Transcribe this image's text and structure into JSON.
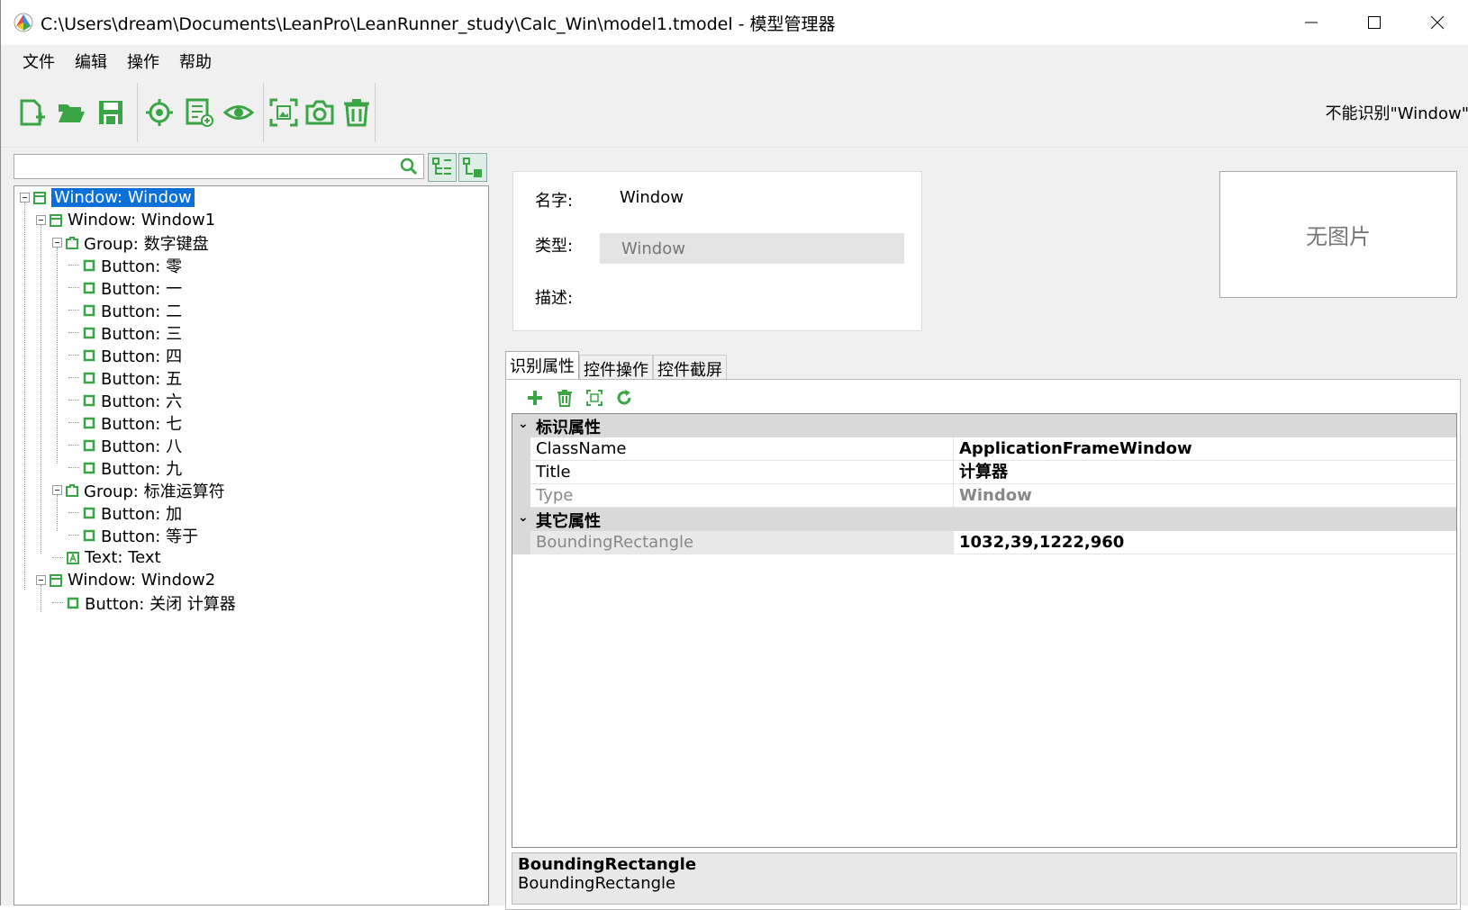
{
  "window": {
    "title": "C:\\Users\\dream\\Documents\\LeanPro\\LeanRunner_study\\Calc_Win\\model1.tmodel - 模型管理器"
  },
  "menu": [
    "文件",
    "编辑",
    "操作",
    "帮助"
  ],
  "toolbar": {
    "status_text": "不能识别\"Window\""
  },
  "tree": {
    "items": [
      {
        "label": "Window: Window"
      },
      {
        "label": "Window: Window1"
      },
      {
        "label": "Group: 数字键盘"
      },
      {
        "label": "Button: 零"
      },
      {
        "label": "Button: 一"
      },
      {
        "label": "Button: 二"
      },
      {
        "label": "Button: 三"
      },
      {
        "label": "Button: 四"
      },
      {
        "label": "Button: 五"
      },
      {
        "label": "Button: 六"
      },
      {
        "label": "Button: 七"
      },
      {
        "label": "Button: 八"
      },
      {
        "label": "Button: 九"
      },
      {
        "label": "Group: 标准运算符"
      },
      {
        "label": "Button: 加"
      },
      {
        "label": "Button: 等于"
      },
      {
        "label": "Text: Text"
      },
      {
        "label": "Window: Window2"
      },
      {
        "label": "Button: 关闭 计算器"
      }
    ]
  },
  "info": {
    "name_label": "名字:",
    "name_value": "Window",
    "type_label": "类型:",
    "type_value": "Window",
    "desc_label": "描述:",
    "image_placeholder": "无图片"
  },
  "tabs": [
    "识别属性",
    "控件操作",
    "控件截屏"
  ],
  "properties": {
    "cat1": "标识属性",
    "cat2": "其它属性",
    "rows": [
      {
        "name": "ClassName",
        "value": "ApplicationFrameWindow"
      },
      {
        "name": "Title",
        "value": "计算器"
      },
      {
        "name": "Type",
        "value": "Window"
      },
      {
        "name": "BoundingRectangle",
        "value": "1032,39,1222,960"
      }
    ]
  },
  "description": {
    "title": "BoundingRectangle",
    "text": "BoundingRectangle"
  },
  "colors": {
    "accent_green": "#3aa544",
    "selection_blue": "#0a6fd6"
  }
}
